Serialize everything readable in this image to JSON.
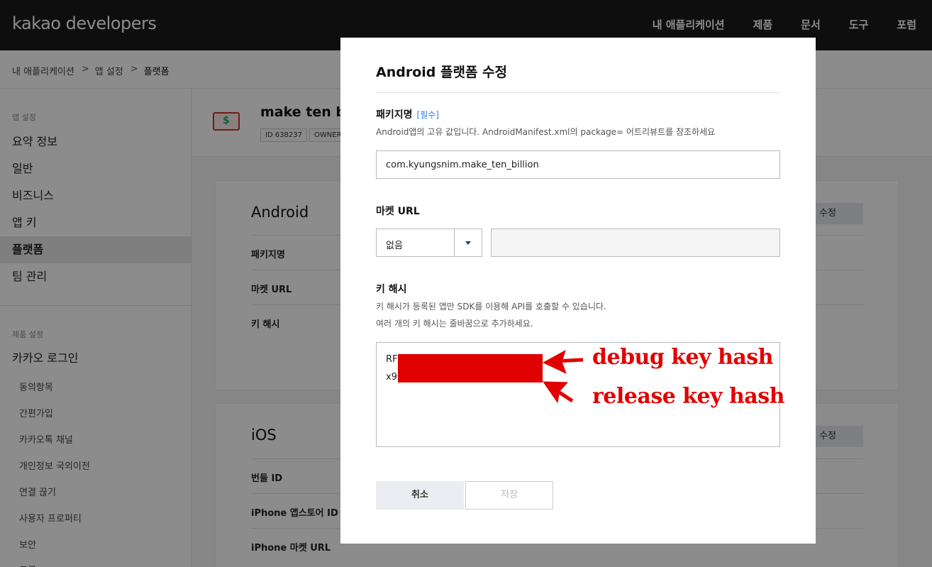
{
  "header": {
    "logo": "kakao developers",
    "nav": [
      "내 애플리케이션",
      "제품",
      "문서",
      "도구",
      "포럼"
    ]
  },
  "breadcrumb": [
    "내 애플리케이션",
    "앱 설정",
    "플랫폼"
  ],
  "sidebar": {
    "section1": "앱 설정",
    "items": [
      "요약 정보",
      "일반",
      "비즈니스",
      "앱 키",
      "플랫폼",
      "팀 관리"
    ],
    "active": "플랫폼",
    "section2": "제품 설정",
    "product": "카카오 로그인",
    "subitems": [
      "동의항목",
      "간편가입",
      "카카오톡 채널",
      "개인정보 국외이전",
      "연결 끊기",
      "사용자 프로퍼티",
      "보안",
      "고급"
    ]
  },
  "app": {
    "name": "make ten bil",
    "tags": [
      "ID 638237",
      "OWNER"
    ]
  },
  "android_card": {
    "title": "Android",
    "edit": "수정",
    "rows": [
      "패키지명",
      "마켓 URL",
      "키 해시"
    ]
  },
  "ios_card": {
    "title": "iOS",
    "edit": "수정",
    "rows": [
      "번들 ID",
      "iPhone 앱스토어 ID",
      "iPhone 마켓 URL"
    ]
  },
  "modal": {
    "title": "Android 플랫폼 수정",
    "package": {
      "label": "패키지명",
      "required": "[필수]",
      "desc": "Android앱의 고유 값입니다. AndroidManifest.xml의 package= 어트리뷰트를 참조하세요",
      "value": "com.kyungsnim.make_ten_billion"
    },
    "market": {
      "label": "마켓 URL",
      "select_value": "없음",
      "url_value": ""
    },
    "keyhash": {
      "label": "키 해시",
      "desc1": "키 해시가 등록된 앱만 SDK를 이용해 API를 호출할 수 있습니다.",
      "desc2": "여러 개의 키 해시는 줄바꿈으로 추가하세요.",
      "line1": "RF",
      "line2": "x9s"
    },
    "cancel": "취소",
    "save": "저장"
  },
  "annotations": {
    "debug": "debug key hash",
    "release": "release key hash",
    "color": "#e10000"
  }
}
